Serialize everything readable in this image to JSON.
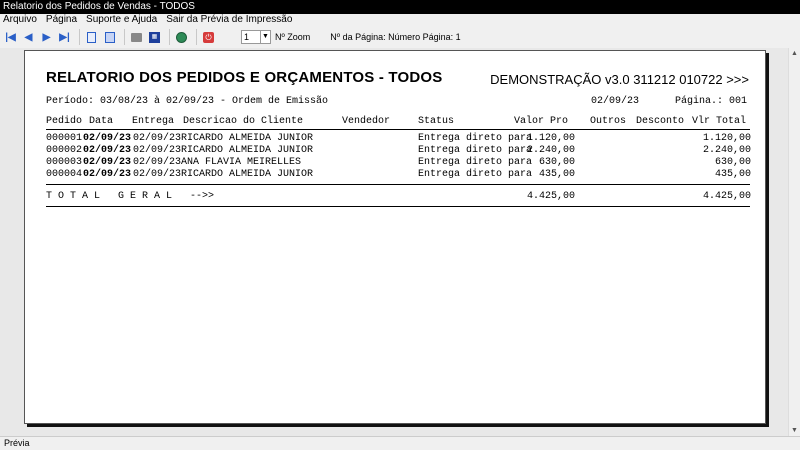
{
  "window": {
    "title": "Relatorio dos Pedidos de Vendas - TODOS"
  },
  "menu": [
    "Arquivo",
    "Página",
    "Suporte e Ajuda",
    "Sair da Prévia de Impressão"
  ],
  "toolbar": {
    "zoom_value": "1",
    "zoom_label": "Nº Zoom",
    "page_label": "Nº da Página: Número Página: 1"
  },
  "report": {
    "title": "RELATORIO DOS PEDIDOS E ORÇAMENTOS - TODOS",
    "demo": "DEMONSTRAÇÃO v3.0 311212 010722 >>>",
    "period": "Período: 03/08/23 à 02/09/23 - Ordem de Emissão",
    "date": "02/09/23",
    "page": "Página.: 001",
    "headers": {
      "pedido": "Pedido",
      "data": "Data",
      "entrega": "Entrega",
      "cliente": "Descricao do Cliente",
      "vendedor": "Vendedor",
      "status": "Status",
      "valor": "Valor Pro",
      "outros": "Outros",
      "desconto": "Desconto",
      "total": "Vlr Total"
    },
    "rows": [
      {
        "pedido": "000001",
        "data": "02/09/23",
        "entrega": "02/09/23",
        "cliente": "RICARDO ALMEIDA JUNIOR",
        "status": "Entrega direto para",
        "valor": "1.120,00",
        "total": "1.120,00"
      },
      {
        "pedido": "000002",
        "data": "02/09/23",
        "entrega": "02/09/23",
        "cliente": "RICARDO ALMEIDA JUNIOR",
        "status": "Entrega direto para",
        "valor": "2.240,00",
        "total": "2.240,00"
      },
      {
        "pedido": "000003",
        "data": "02/09/23",
        "entrega": "02/09/23",
        "cliente": "ANA FLAVIA MEIRELLES",
        "status": "Entrega direto para",
        "valor": "630,00",
        "total": "630,00"
      },
      {
        "pedido": "000004",
        "data": "02/09/23",
        "entrega": "02/09/23",
        "cliente": "RICARDO ALMEIDA JUNIOR",
        "status": "Entrega direto para",
        "valor": "435,00",
        "total": "435,00"
      }
    ],
    "total_label": "T O T A L   G E R A L   -->>",
    "total_valor": "4.425,00",
    "total_geral": "4.425,00"
  },
  "status": {
    "text": "Prévia"
  }
}
